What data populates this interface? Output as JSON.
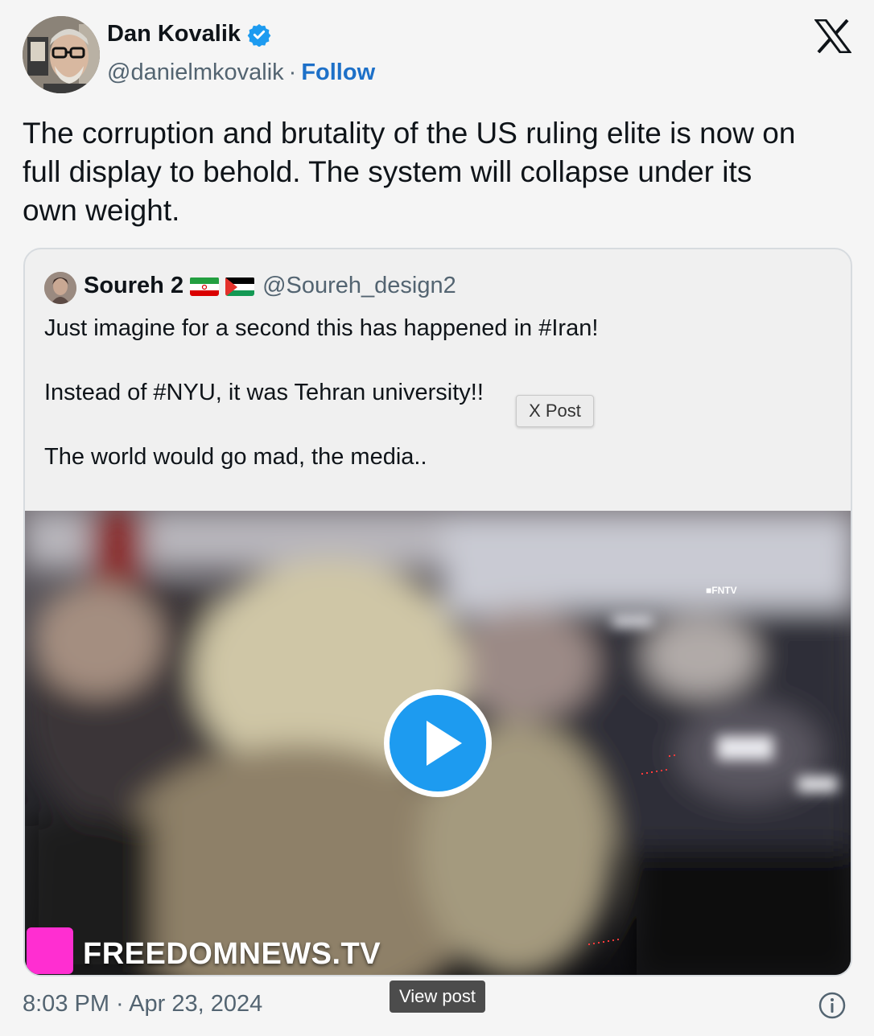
{
  "author": {
    "name": "Dan Kovalik",
    "handle": "@danielmkovalik",
    "separator": "·",
    "follow_label": "Follow"
  },
  "tweet": {
    "text_lines": [
      "The corruption and brutality of the US ruling elite is now on",
      "full display to behold.  The system will collapse under its",
      "own weight."
    ],
    "timestamp": "8:03 PM · Apr 23, 2024"
  },
  "quoted": {
    "name": "Soureh 2",
    "handle": "@Soureh_design2",
    "lines": [
      "Just imagine for a second this has happened in #Iran!",
      "Instead of #NYU, it was Tehran university!!",
      "The world would go mad, the media.."
    ],
    "video_watermark": "FREEDOMNEWS.TV",
    "video_corner_label": "■FNTV"
  },
  "tooltip_label": "X Post",
  "view_post_label": "View post",
  "icons": {
    "verified": "verified-badge-icon",
    "logo": "x-logo-icon",
    "play": "play-icon",
    "info": "info-icon"
  },
  "colors": {
    "link": "#1d70c8",
    "verified": "#1d9bf0",
    "play": "#1d9bf0",
    "secondary_text": "#536471",
    "watermark_square": "#ff2ed1"
  }
}
